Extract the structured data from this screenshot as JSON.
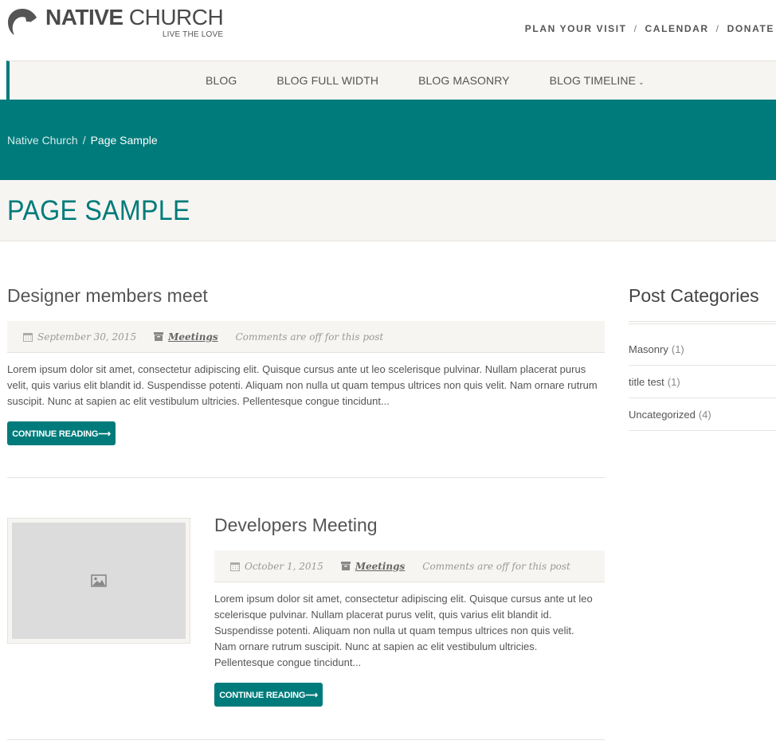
{
  "header": {
    "logo_bold": "NATIVE",
    "logo_light": " CHURCH",
    "tagline": "LIVE THE LOVE",
    "top_links": [
      "PLAN YOUR VISIT",
      "CALENDAR",
      "DONATE"
    ],
    "separator": "/"
  },
  "nav": {
    "items": [
      "BLOG",
      "BLOG FULL WIDTH",
      "BLOG MASONRY",
      "BLOG TIMELINE"
    ]
  },
  "breadcrumb": {
    "home": "Native Church",
    "separator": "/",
    "current": "Page Sample"
  },
  "page": {
    "title": "PAGE SAMPLE"
  },
  "posts": [
    {
      "title": "Designer members meet",
      "date": "September 30, 2015",
      "category": "Meetings",
      "comments": "Comments are off for this post",
      "excerpt": "Lorem ipsum dolor sit amet, consectetur adipiscing elit. Quisque cursus ante ut leo scelerisque pulvinar. Nullam placerat purus velit, quis varius elit blandit id. Suspendisse potenti. Aliquam non nulla ut quam tempus ultrices non quis velit. Nam ornare rutrum suscipit. Nunc at sapien ac elit vestibulum ultricies. Pellentesque congue tincidunt...",
      "button": "CONTINUE READING⟶"
    },
    {
      "title": "Developers Meeting",
      "date": "October 1, 2015",
      "category": "Meetings",
      "comments": "Comments are off for this post",
      "excerpt": "Lorem ipsum dolor sit amet, consectetur adipiscing elit. Quisque cursus ante ut leo scelerisque pulvinar. Nullam placerat purus velit, quis varius elit blandit id. Suspendisse potenti. Aliquam non nulla ut quam tempus ultrices non quis velit. Nam ornare rutrum suscipit. Nunc at sapien ac elit vestibulum ultricies. Pellentesque congue tincidunt...",
      "button": "CONTINUE READING⟶"
    }
  ],
  "sidebar": {
    "title": "Post Categories",
    "categories": [
      {
        "name": "Masonry",
        "count": "(1)"
      },
      {
        "name": "title test",
        "count": "(1)"
      },
      {
        "name": "Uncategorized",
        "count": "(4)"
      }
    ]
  },
  "colors": {
    "accent": "#007b7b",
    "panel": "#f7f5f2"
  },
  "icons": {
    "date": "calendar-icon",
    "category": "archive-icon",
    "placeholder": "image-placeholder-icon",
    "dropdown": "chevron-down-icon"
  }
}
